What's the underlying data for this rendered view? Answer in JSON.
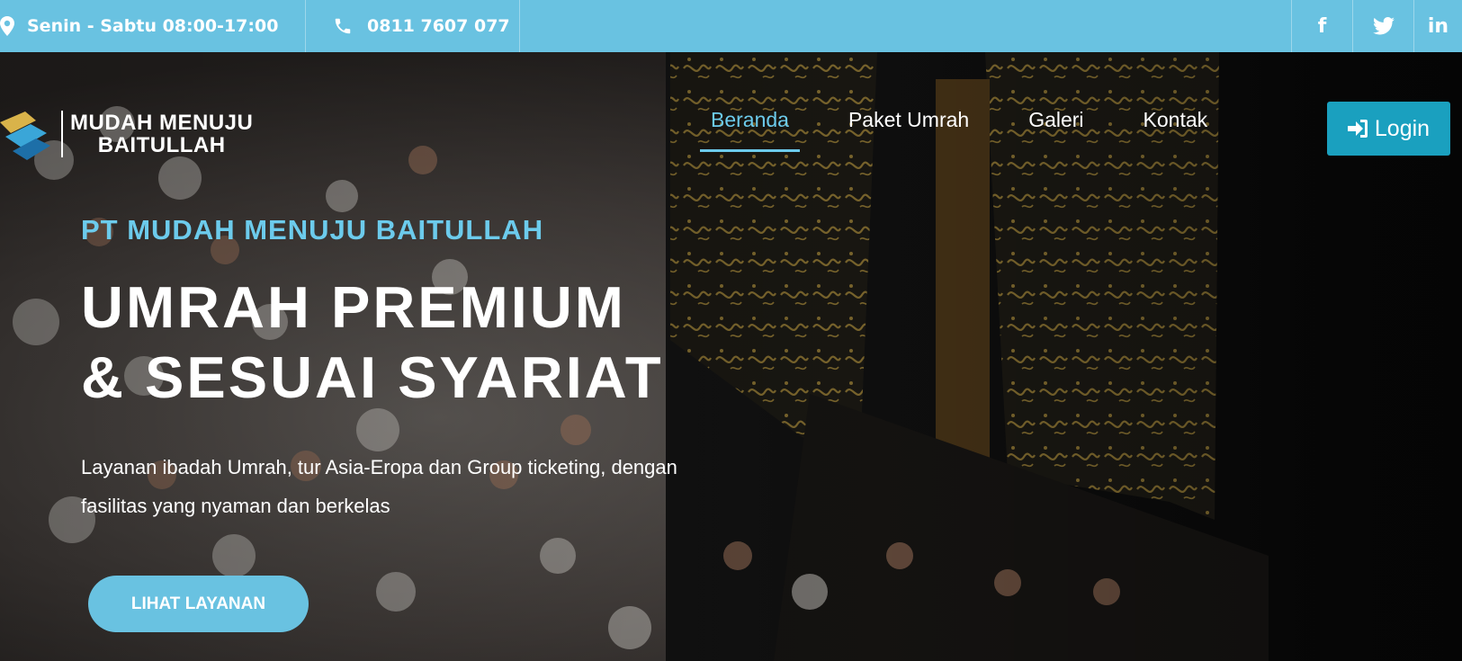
{
  "topbar": {
    "hours": "Senin - Sabtu 08:00-17:00",
    "phone": "0811 7607 077",
    "social": {
      "facebook": "f",
      "linkedin": "in"
    },
    "icons": [
      "map-pin-icon",
      "phone-icon",
      "facebook-icon",
      "twitter-icon",
      "linkedin-icon"
    ],
    "color": "#69c2e1"
  },
  "header": {
    "logo_line1": "MUDAH MENUJU",
    "logo_line2": "BAITULLAH",
    "nav": [
      "Beranda",
      "Paket Umrah",
      "Galeri",
      "Kontak"
    ],
    "active_nav": "Beranda",
    "login_label": "Login",
    "login_color": "#1aa0bf"
  },
  "hero": {
    "kicker": "PT MUDAH MENUJU BAITULLAH",
    "headline_line1": "UMRAH PREMIUM",
    "headline_line2": "& SESUAI SYARIAT",
    "description_line1": "Layanan ibadah Umrah, tur Asia-Eropa dan Group ticketing, dengan",
    "description_line2": "fasilitas yang nyaman dan berkelas",
    "cta_label": "LIHAT LAYANAN",
    "accent": "#6ccbec"
  }
}
